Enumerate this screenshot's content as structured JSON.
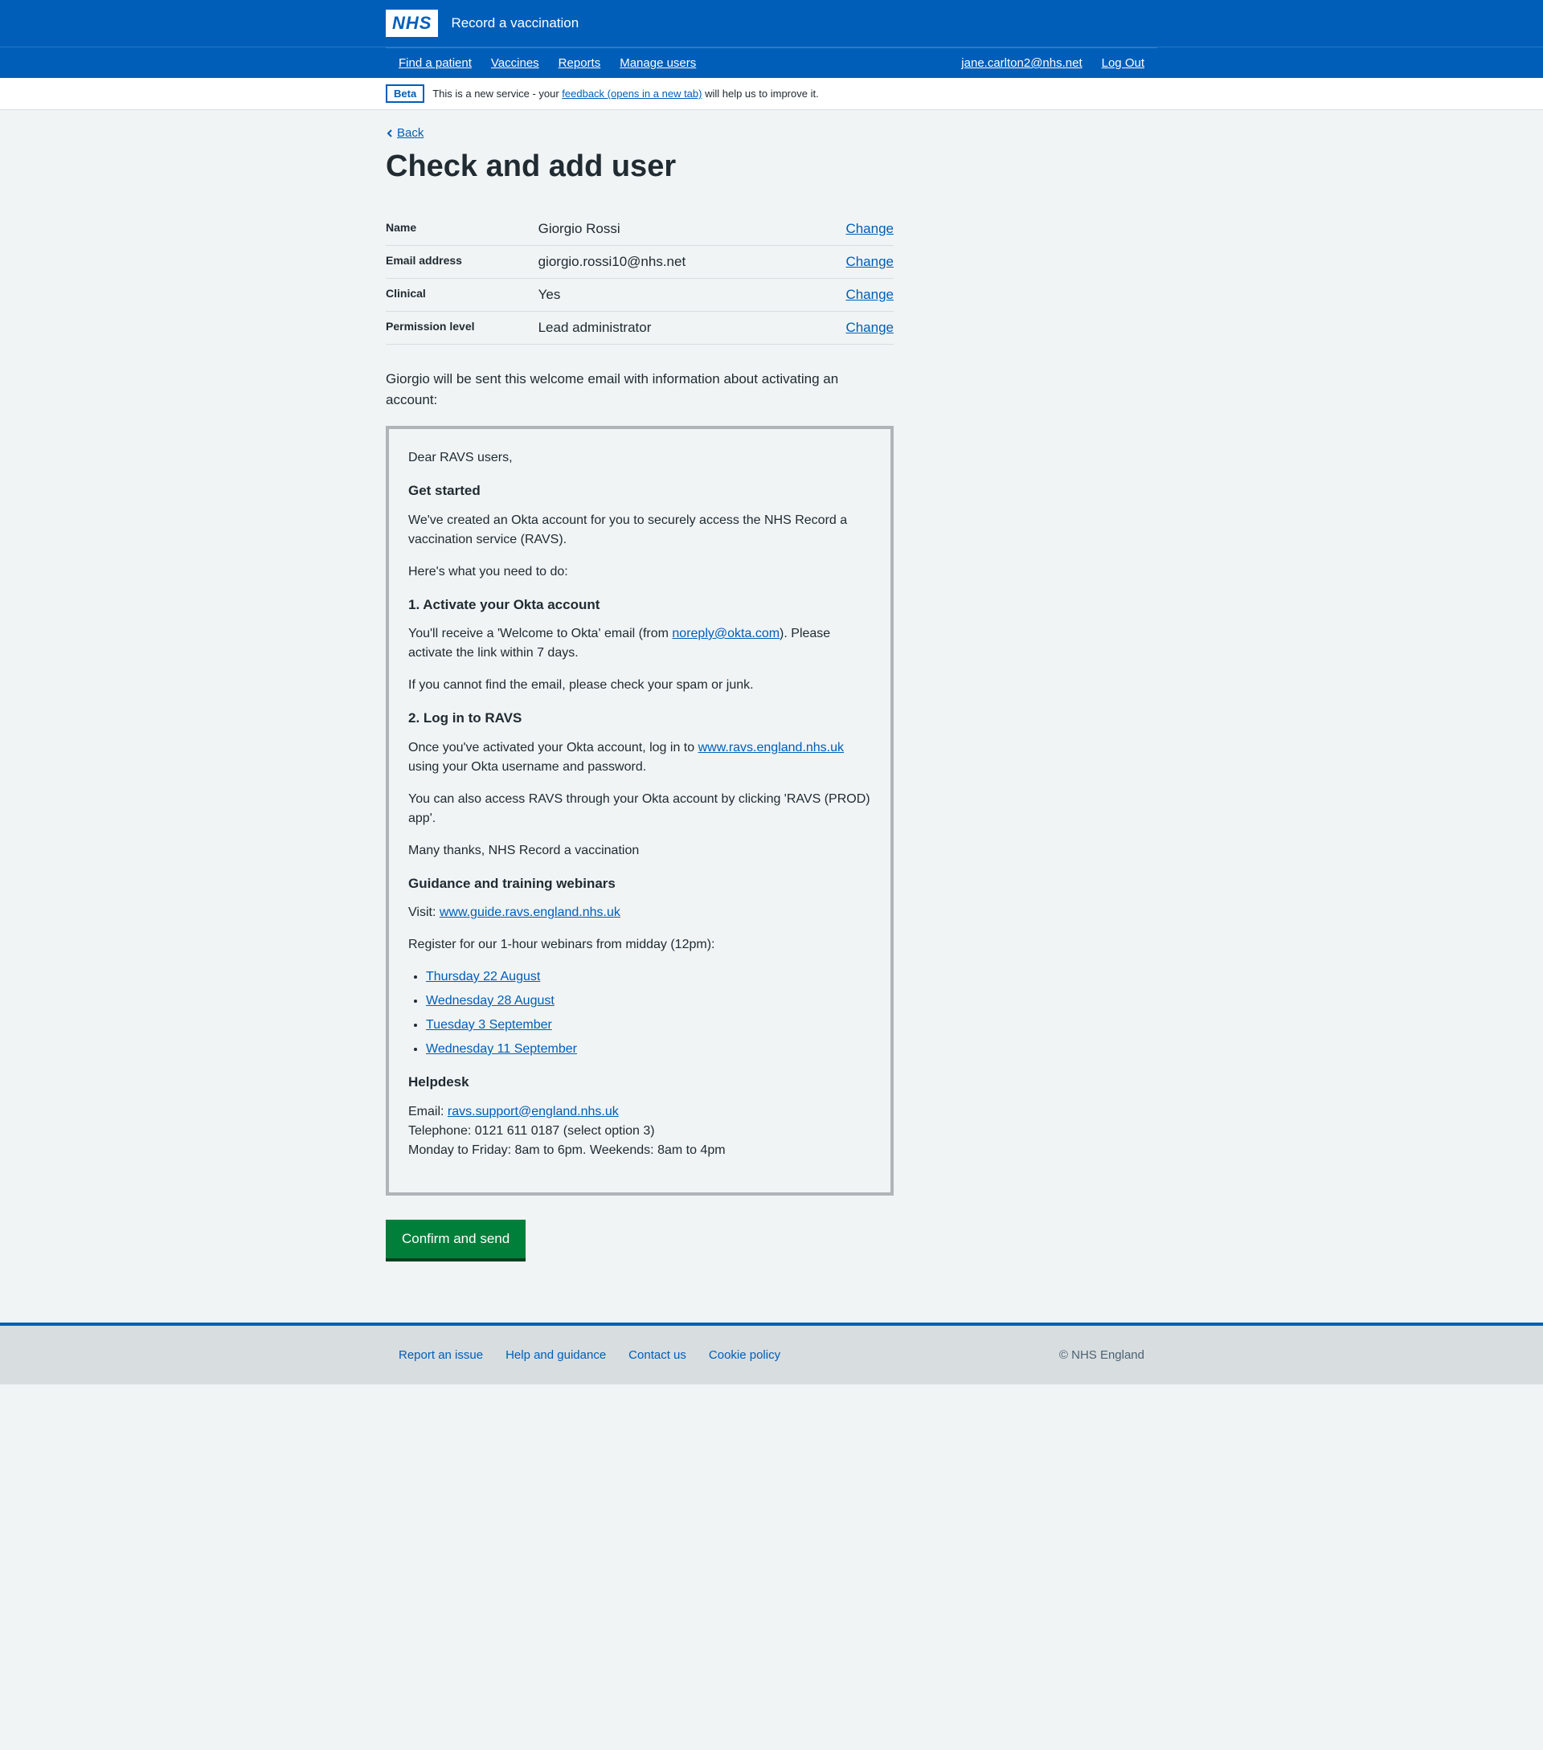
{
  "header": {
    "logo": "NHS",
    "service_name": "Record a vaccination"
  },
  "nav": {
    "find_patient": "Find a patient",
    "vaccines": "Vaccines",
    "reports": "Reports",
    "manage_users": "Manage users",
    "user_email": "jane.carlton2@nhs.net",
    "logout": "Log Out"
  },
  "beta": {
    "tag": "Beta",
    "prefix": "This is a new service - your ",
    "link": "feedback (opens in a new tab)",
    "suffix": " will help us to improve it."
  },
  "back": "Back",
  "page_title": "Check and add user",
  "summary": {
    "name_key": "Name",
    "name_value": "Giorgio Rossi",
    "email_key": "Email address",
    "email_value": "giorgio.rossi10@nhs.net",
    "clinical_key": "Clinical",
    "clinical_value": "Yes",
    "permission_key": "Permission level",
    "permission_value": "Lead administrator",
    "change": "Change"
  },
  "intro": "Giorgio will be sent this welcome email with information about activating an account:",
  "email": {
    "greeting": "Dear RAVS users,",
    "h_get_started": "Get started",
    "p_created": "We've created an Okta account for you to securely access the NHS Record a vaccination service (RAVS).",
    "p_here": "Here's what you need to do:",
    "h_activate": "1. Activate your Okta account",
    "p_welcome_prefix": "You'll receive a 'Welcome to Okta' email (from ",
    "noreply": "noreply@okta.com",
    "p_welcome_suffix": "). Please activate the link within 7 days.",
    "p_spam": "If you cannot find the email, please check your spam or junk.",
    "h_login": "2. Log in to RAVS",
    "p_login_prefix": "Once you've activated your Okta account, log in to ",
    "ravs_url": "www.ravs.england.nhs.uk",
    "p_login_suffix": " using your Okta username and password.",
    "p_access": "You can also access RAVS through your Okta account by clicking 'RAVS (PROD) app'.",
    "p_thanks": "Many thanks, NHS Record a vaccination",
    "h_guidance": "Guidance and training webinars",
    "p_visit_prefix": "Visit: ",
    "guide_url": "www.guide.ravs.england.nhs.uk",
    "p_register": "Register for our 1-hour webinars from midday (12pm):",
    "webinars": [
      "Thursday 22 August",
      "Wednesday 28 August",
      "Tuesday 3 September",
      "Wednesday 11 September"
    ],
    "h_helpdesk": "Helpdesk",
    "p_email_prefix": "Email: ",
    "support_email": "ravs.support@england.nhs.uk",
    "p_telephone": "Telephone: 0121 611 0187 (select option 3)",
    "p_hours": "Monday to Friday: 8am to 6pm. Weekends: 8am to 4pm"
  },
  "confirm_button": "Confirm and send",
  "footer": {
    "report": "Report an issue",
    "help": "Help and guidance",
    "contact": "Contact us",
    "cookie": "Cookie policy",
    "copyright": "© NHS England"
  }
}
